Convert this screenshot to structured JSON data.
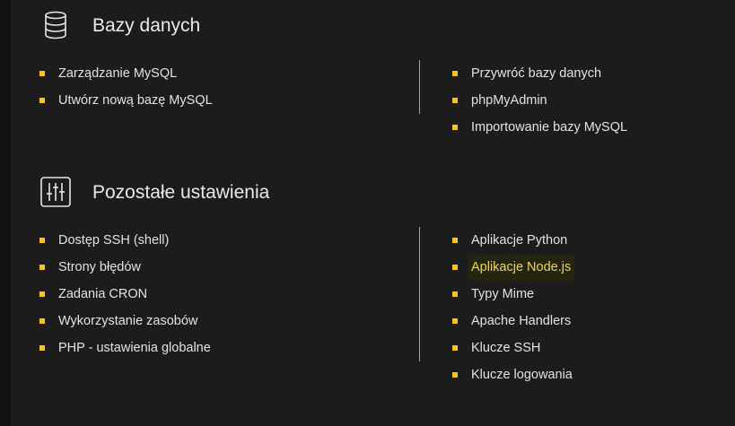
{
  "sections": [
    {
      "title": "Bazy danych",
      "icon": "database-icon",
      "left_items": [
        {
          "label": "Zarządzanie MySQL"
        },
        {
          "label": "Utwórz nową bazę MySQL"
        }
      ],
      "right_items": [
        {
          "label": "Przywróć bazy danych"
        },
        {
          "label": "phpMyAdmin"
        },
        {
          "label": "Importowanie bazy MySQL"
        }
      ]
    },
    {
      "title": "Pozostałe ustawienia",
      "icon": "settings-sliders-icon",
      "left_items": [
        {
          "label": "Dostęp SSH (shell)"
        },
        {
          "label": "Strony błędów"
        },
        {
          "label": "Zadania CRON"
        },
        {
          "label": "Wykorzystanie zasobów"
        },
        {
          "label": "PHP - ustawienia globalne"
        }
      ],
      "right_items": [
        {
          "label": "Aplikacje Python"
        },
        {
          "label": "Aplikacje Node.js",
          "highlighted": true
        },
        {
          "label": "Typy Mime"
        },
        {
          "label": "Apache Handlers"
        },
        {
          "label": "Klucze SSH"
        },
        {
          "label": "Klucze logowania"
        }
      ]
    }
  ],
  "colors": {
    "accent": "#f5c518",
    "background": "#1c1c1c",
    "text": "#e2e2e2",
    "highlight_text": "#e8d94a"
  }
}
